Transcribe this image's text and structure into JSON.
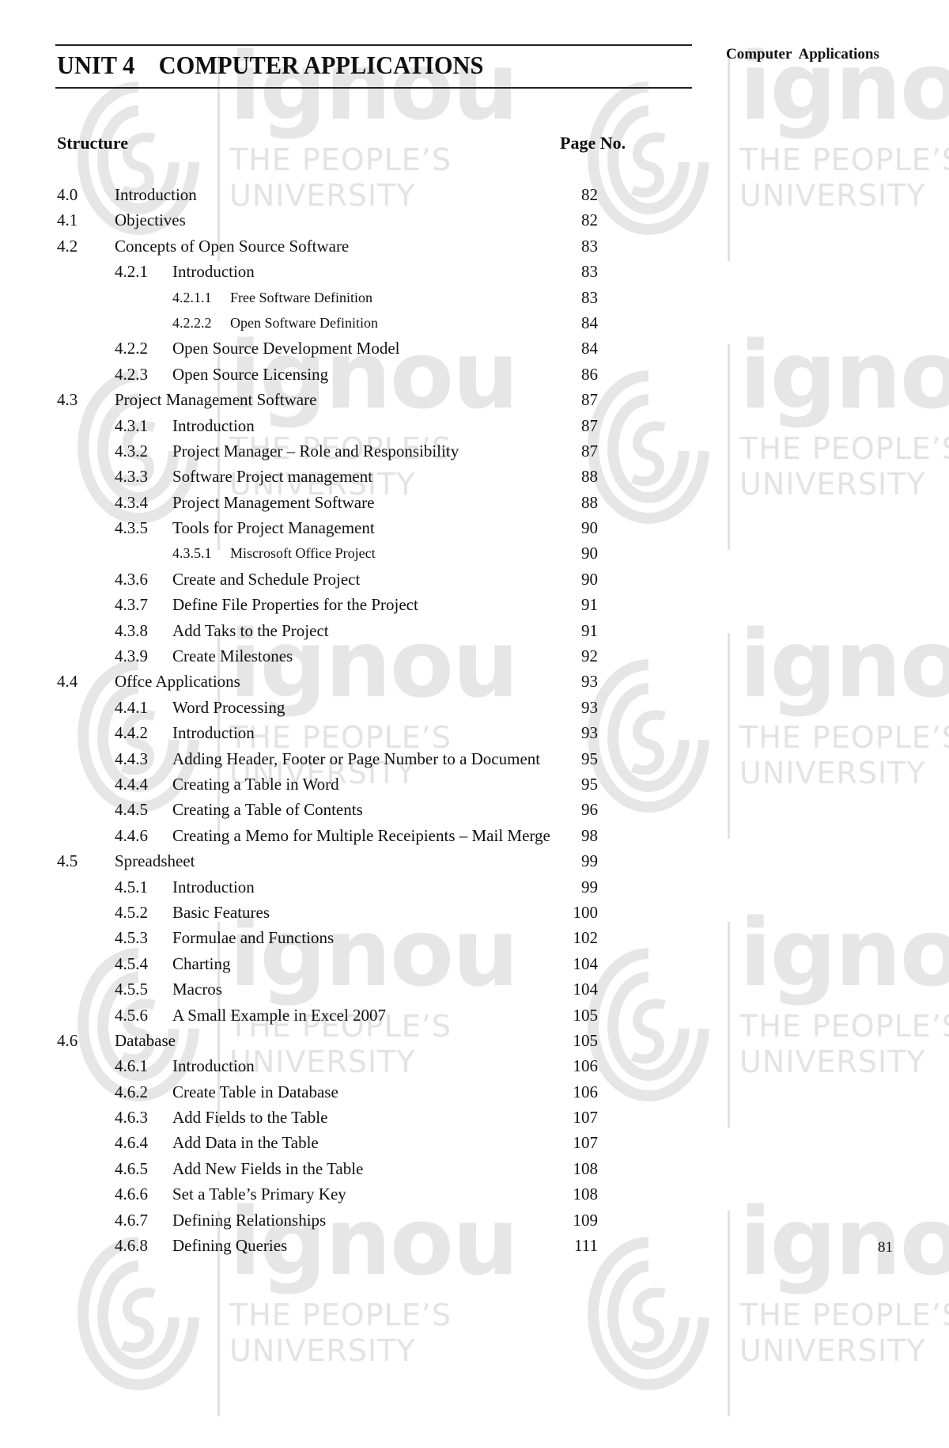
{
  "header": {
    "unit_title": "UNIT 4    COMPUTER APPLICATIONS",
    "running_head": "Computer  Applications"
  },
  "toc": {
    "structure_label": "Structure",
    "page_no_label": "Page No.",
    "entries": [
      {
        "num": "4.0",
        "title": "Introduction",
        "page": "82",
        "level": 1
      },
      {
        "num": "4.1",
        "title": "Objectives",
        "page": "82",
        "level": 1
      },
      {
        "num": "4.2",
        "title": "Concepts of Open Source Software",
        "page": "83",
        "level": 1
      },
      {
        "num": "4.2.1",
        "title": "Introduction",
        "page": "83",
        "level": 2
      },
      {
        "num": "4.2.1.1",
        "title": "Free Software Definition",
        "page": "83",
        "level": 3
      },
      {
        "num": "4.2.2.2",
        "title": "Open Software Definition",
        "page": "84",
        "level": 3
      },
      {
        "num": "4.2.2",
        "title": "Open Source Development Model",
        "page": "84",
        "level": 2
      },
      {
        "num": "4.2.3",
        "title": "Open Source Licensing",
        "page": "86",
        "level": 2
      },
      {
        "num": "4.3",
        "title": "Project Management Software",
        "page": "87",
        "level": 1
      },
      {
        "num": "4.3.1",
        "title": "Introduction",
        "page": "87",
        "level": 2
      },
      {
        "num": "4.3.2",
        "title": "Project Manager – Role and Responsibility",
        "page": "87",
        "level": 2
      },
      {
        "num": "4.3.3",
        "title": "Software Project management",
        "page": "88",
        "level": 2
      },
      {
        "num": "4.3.4",
        "title": "Project Management Software",
        "page": "88",
        "level": 2
      },
      {
        "num": "4.3.5",
        "title": "Tools for Project Management",
        "page": "90",
        "level": 2
      },
      {
        "num": "4.3.5.1",
        "title": "Miscrosoft Office Project",
        "page": "90",
        "level": 3
      },
      {
        "num": "4.3.6",
        "title": "Create and Schedule Project",
        "page": "90",
        "level": 2
      },
      {
        "num": "4.3.7",
        "title": "Define File Properties for the Project",
        "page": "91",
        "level": 2
      },
      {
        "num": "4.3.8",
        "title": "Add Taks to the Project",
        "page": "91",
        "level": 2
      },
      {
        "num": "4.3.9",
        "title": "Create Milestones",
        "page": "92",
        "level": 2
      },
      {
        "num": "4.4",
        "title": "Offce Applications",
        "page": "93",
        "level": 1
      },
      {
        "num": "4.4.1",
        "title": "Word Processing",
        "page": "93",
        "level": 2
      },
      {
        "num": "4.4.2",
        "title": "Introduction",
        "page": "93",
        "level": 2
      },
      {
        "num": "4.4.3",
        "title": "Adding Header, Footer or Page Number to a Document",
        "page": "95",
        "level": 2
      },
      {
        "num": "4.4.4",
        "title": "Creating a Table in Word",
        "page": "95",
        "level": 2
      },
      {
        "num": "4.4.5",
        "title": "Creating a Table of Contents",
        "page": "96",
        "level": 2
      },
      {
        "num": "4.4.6",
        "title": "Creating a Memo for Multiple Receipients – Mail Merge",
        "page": "98",
        "level": 2
      },
      {
        "num": "4.5",
        "title": "Spreadsheet",
        "page": "99",
        "level": 1
      },
      {
        "num": "4.5.1",
        "title": "Introduction",
        "page": "99",
        "level": 2
      },
      {
        "num": "4.5.2",
        "title": "Basic Features",
        "page": "100",
        "level": 2
      },
      {
        "num": "4.5.3",
        "title": "Formulae and Functions",
        "page": "102",
        "level": 2
      },
      {
        "num": "4.5.4",
        "title": "Charting",
        "page": "104",
        "level": 2
      },
      {
        "num": "4.5.5",
        "title": "Macros",
        "page": "104",
        "level": 2
      },
      {
        "num": "4.5.6",
        "title": "A Small Example in Excel 2007",
        "page": "105",
        "level": 2
      },
      {
        "num": "4.6",
        "title": "Database",
        "page": "105",
        "level": 1
      },
      {
        "num": "4.6.1",
        "title": "Introduction",
        "page": "106",
        "level": 2
      },
      {
        "num": "4.6.2",
        "title": "Create Table in Database",
        "page": "106",
        "level": 2
      },
      {
        "num": "4.6.3",
        "title": "Add Fields to the Table",
        "page": "107",
        "level": 2
      },
      {
        "num": "4.6.4",
        "title": "Add Data in the Table",
        "page": "107",
        "level": 2
      },
      {
        "num": "4.6.5",
        "title": "Add New Fields in the Table",
        "page": "108",
        "level": 2
      },
      {
        "num": "4.6.6",
        "title": "Set a Table’s Primary Key",
        "page": "108",
        "level": 2
      },
      {
        "num": "4.6.7",
        "title": "Defining Relationships",
        "page": "109",
        "level": 2
      },
      {
        "num": "4.6.8",
        "title": "Defining Queries",
        "page": "111",
        "level": 2
      }
    ]
  },
  "footer": {
    "page_number": "81"
  },
  "watermark": {
    "brand": "ignou",
    "line1": "THE PEOPLE’S",
    "line2": "UNIVERSITY",
    "color": "#e3e3e3"
  }
}
